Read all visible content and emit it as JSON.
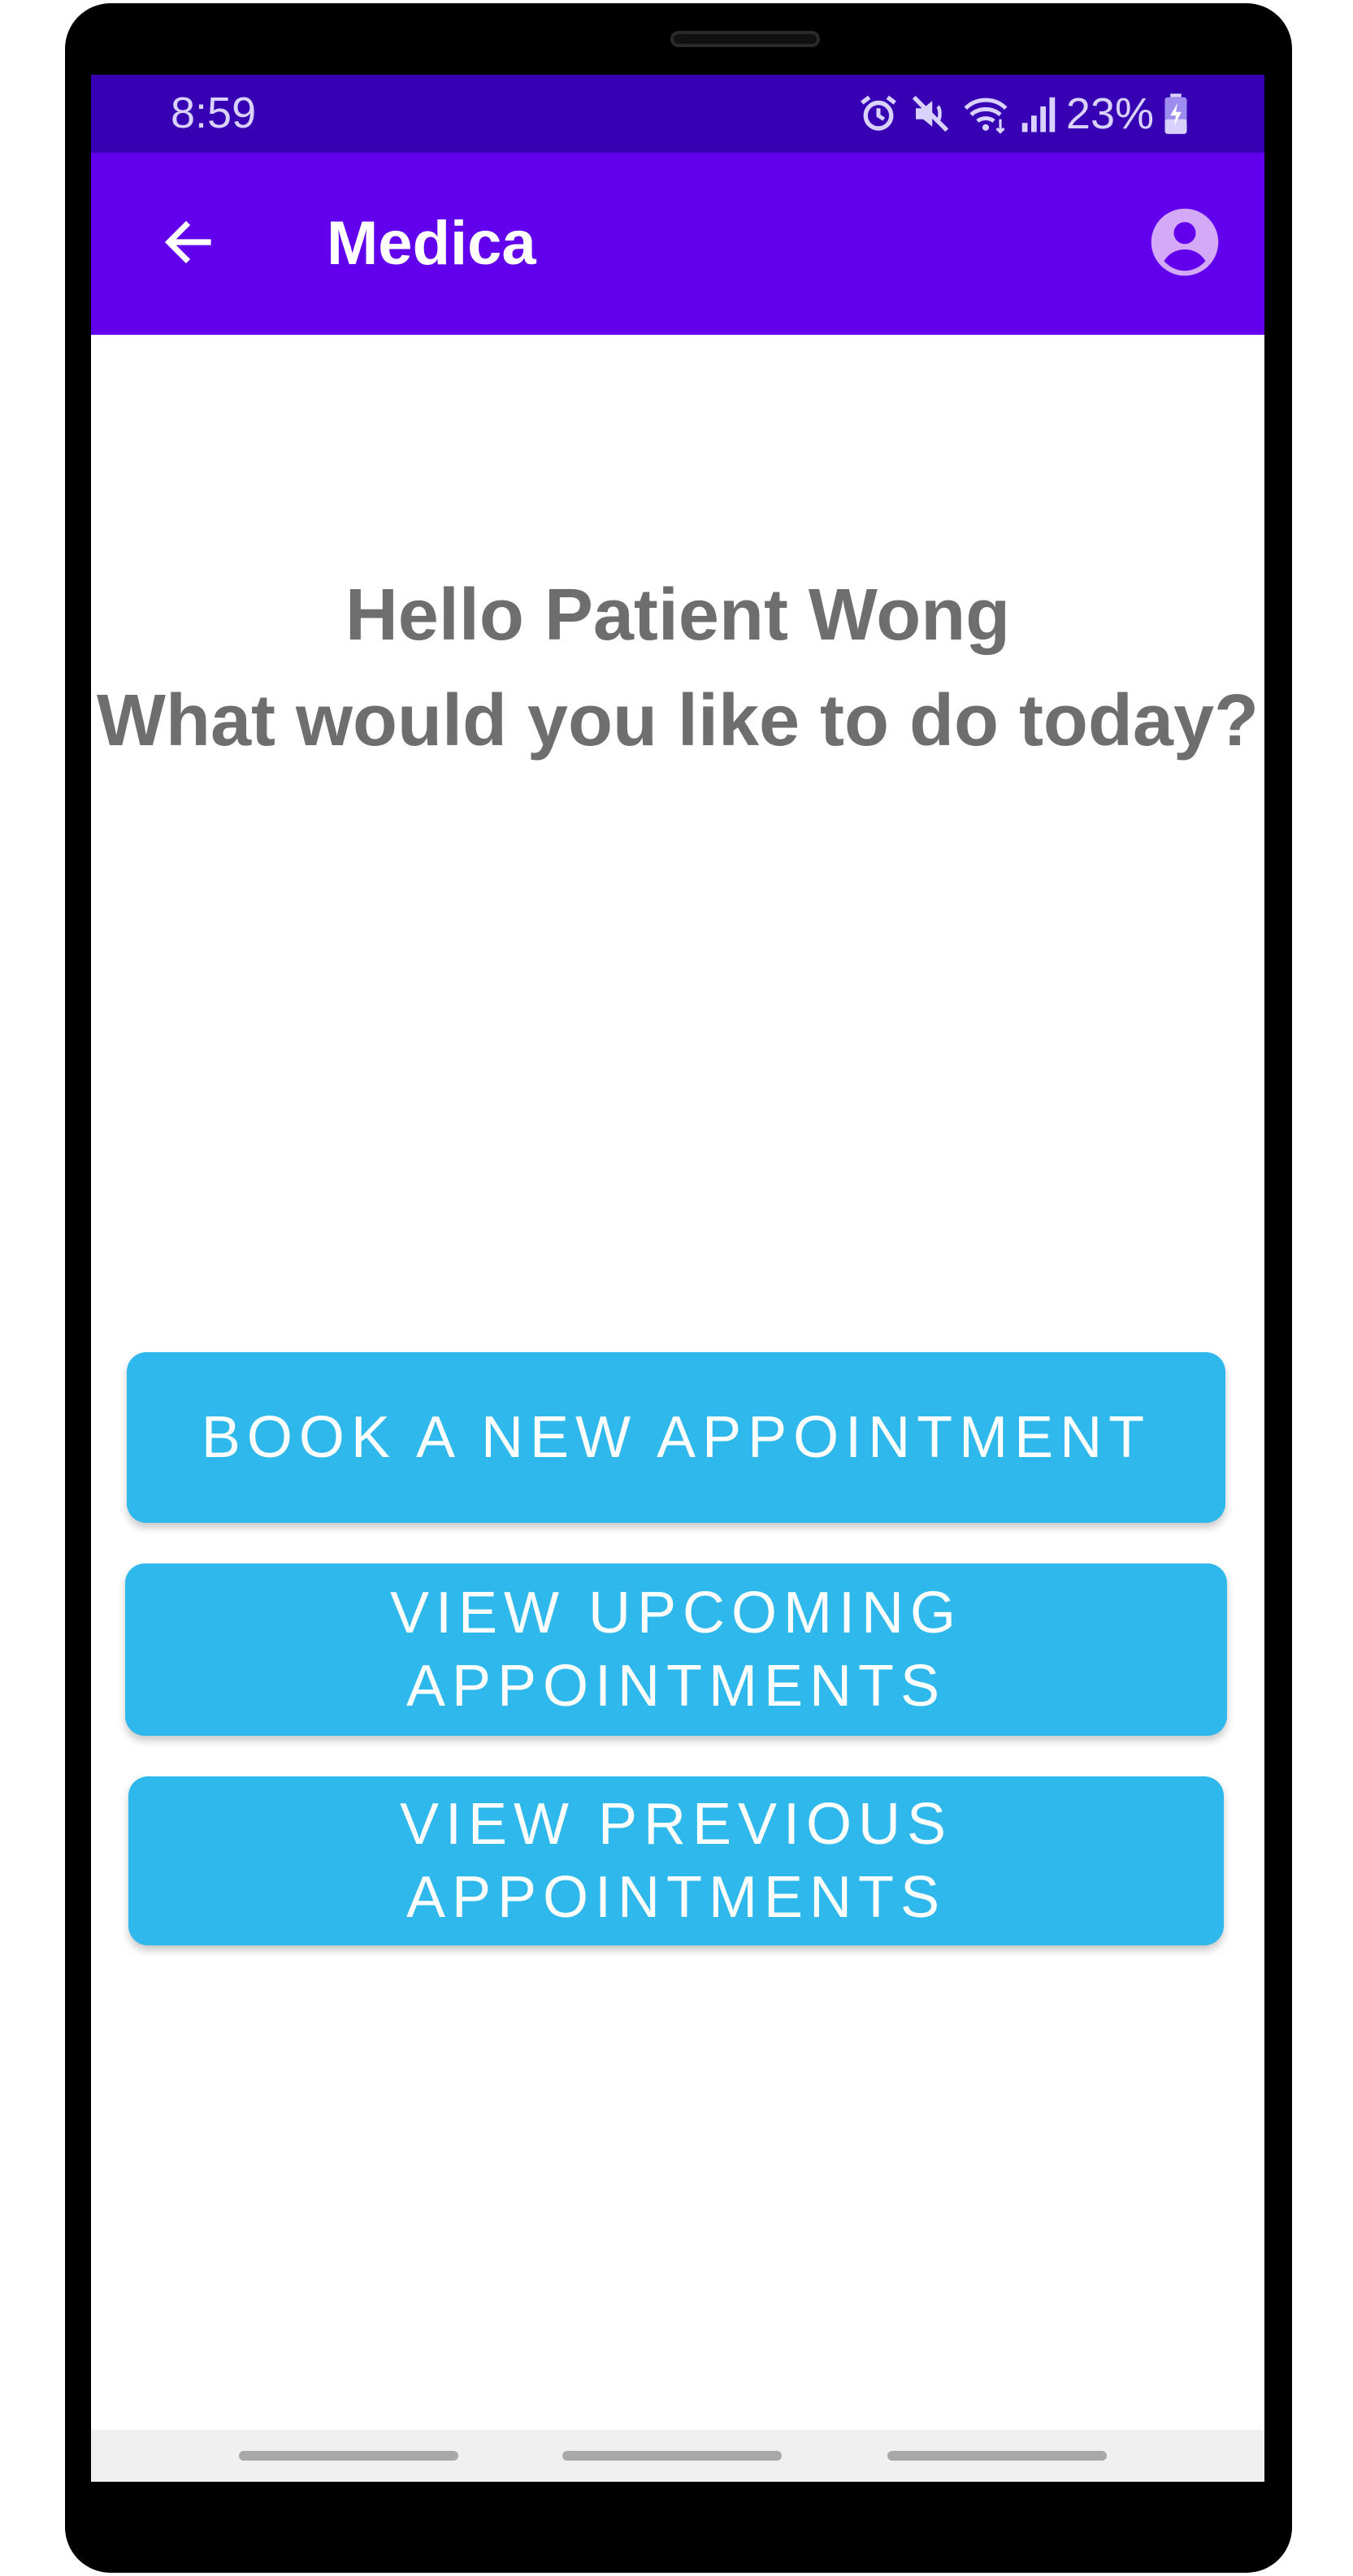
{
  "status_bar": {
    "time": "8:59",
    "battery_percent": "23%",
    "icons": [
      "alarm-icon",
      "mute-icon",
      "wifi-icon",
      "signal-icon",
      "battery-charging-icon"
    ]
  },
  "app_bar": {
    "title": "Medica",
    "back_icon": "arrow-back-icon",
    "account_icon": "account-circle-icon"
  },
  "greeting": {
    "line1": "Hello Patient Wong",
    "line2": "What would you like to do today?"
  },
  "actions": {
    "book": "BOOK A NEW APPOINTMENT",
    "upcoming": "VIEW UPCOMING APPOINTMENTS",
    "previous": "VIEW PREVIOUS APPOINTMENTS"
  },
  "colors": {
    "status_bar": "#3700b3",
    "app_bar": "#6200ee",
    "button": "#2fb8ec",
    "greeting_text": "#6e6e6e"
  }
}
